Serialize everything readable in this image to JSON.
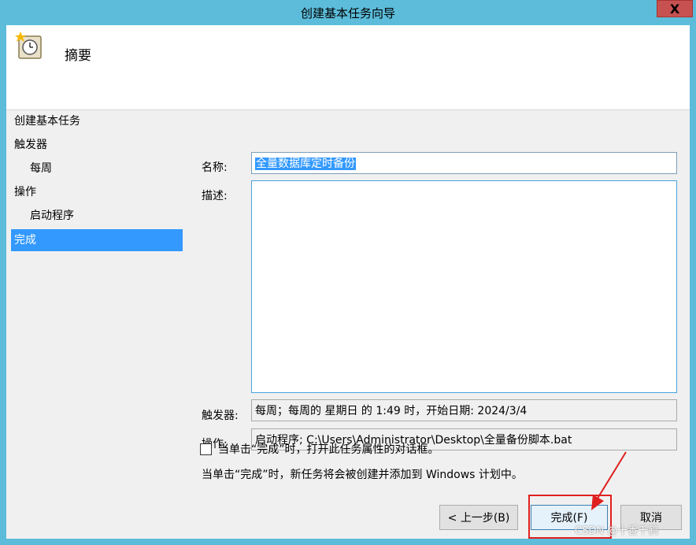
{
  "window": {
    "title": "创建基本任务向导",
    "close_label": "X"
  },
  "header": {
    "title": "摘要",
    "icon": "clock-task-icon"
  },
  "nav": {
    "items": [
      {
        "label": "创建基本任务"
      },
      {
        "label": "触发器"
      },
      {
        "label": "每周"
      },
      {
        "label": "操作"
      },
      {
        "label": "启动程序"
      },
      {
        "label": "完成"
      }
    ],
    "selected_index": 5
  },
  "form": {
    "name_label": "名称:",
    "name_value": "全量数据库定时备份",
    "desc_label": "描述:",
    "desc_value": "",
    "trigger_label": "触发器:",
    "trigger_value": "每周；每周的 星期日 的 1:49 时，开始日期: 2024/3/4",
    "action_label": "操作:",
    "action_value": "启动程序; C:\\Users\\Administrator\\Desktop\\全量备份脚本.bat"
  },
  "checkbox": {
    "label": "当单击“完成”时，打开此任务属性的对话框。",
    "checked": false
  },
  "info_text": "当单击“完成”时，新任务将会被创建并添加到 Windows 计划中。",
  "buttons": {
    "back": "< 上一步(B)",
    "finish": "完成(F)",
    "cancel": "取消"
  },
  "watermark": "CSDN @十香千鹤",
  "colors": {
    "title_bar": "#5cbcda",
    "selection": "#3399ff",
    "annotation": "#e02020"
  }
}
